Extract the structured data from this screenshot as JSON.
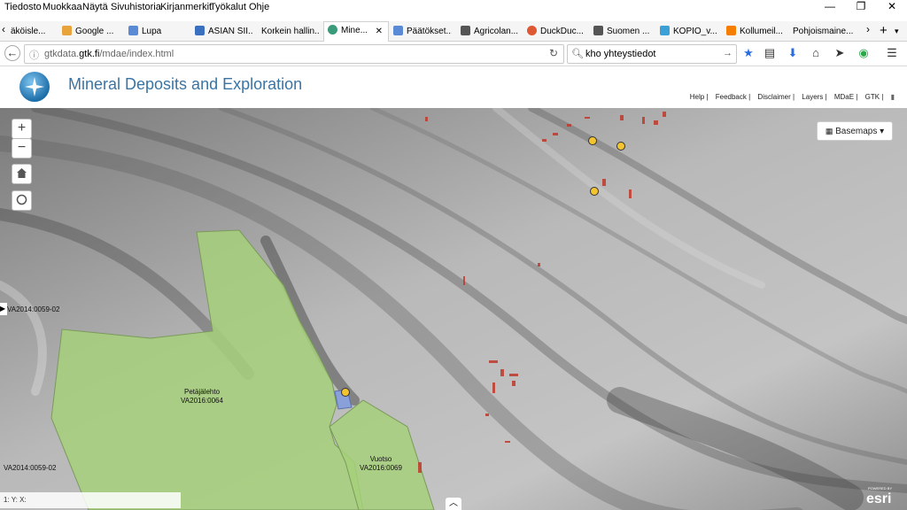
{
  "menu": [
    "Tiedosto",
    "Muokkaa",
    "Näytä",
    "Sivuhistoria",
    "Kirjanmerkit",
    "Työkalut",
    "Ohje"
  ],
  "tabs": [
    {
      "label": "äköisle...",
      "color": "#999"
    },
    {
      "label": "Google ...",
      "color": "#e8a33a"
    },
    {
      "label": "Lupa",
      "color": "#5a8ad6"
    },
    {
      "label": "ASIAN SII...",
      "color": "#3b6fbf"
    },
    {
      "label": "Korkein hallin...",
      "color": "#888"
    },
    {
      "label": "Mine...",
      "color": "#3a9a7a"
    },
    {
      "label": "Päätökset...",
      "color": "#5a8ad6"
    },
    {
      "label": "Agricolan...",
      "color": "#555"
    },
    {
      "label": "DuckDuc...",
      "color": "#de5833"
    },
    {
      "label": "Suomen ...",
      "color": "#555"
    },
    {
      "label": "KOPIO_v...",
      "color": "#3aa0d6"
    },
    {
      "label": "Kollumeil...",
      "color": "#f57d00"
    },
    {
      "label": "Pohjoismaine...",
      "color": "#fff"
    }
  ],
  "url": {
    "prefix": "gtkdata.",
    "domain": "gtk.fi",
    "path": "/mdae/index.html"
  },
  "search": {
    "value": "kho yhteystiedot"
  },
  "app": {
    "title": "Mineral Deposits and Exploration"
  },
  "links": [
    "Help |",
    "Feedback |",
    "Disclaimer |",
    "Layers |",
    "MDaE |",
    "GTK |"
  ],
  "map": {
    "zoom_in": "+",
    "zoom_out": "−",
    "basemaps_label": "Basemaps ▾",
    "coords": "1:  Y:  X:",
    "labels": [
      {
        "text": "VA2014:0059-02"
      },
      {
        "text": "Petäjälehto\nVA2016:0064"
      },
      {
        "text": "Vuotso\nVA2016:0069"
      },
      {
        "text": "VA2014:0059-02"
      }
    ],
    "attribution": "esri",
    "attribution_small": "POWERED BY"
  }
}
